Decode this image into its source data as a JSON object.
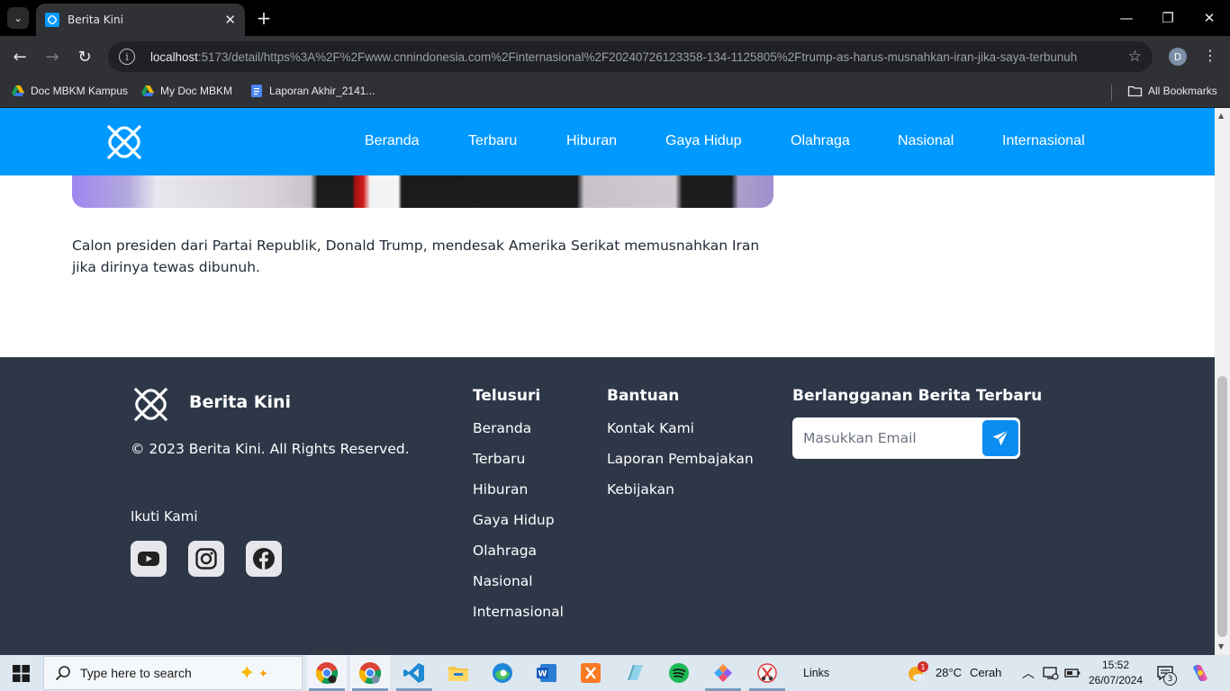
{
  "browser": {
    "tab_title": "Berita Kini",
    "url_host": "localhost",
    "url_rest": ":5173/detail/https%3A%2F%2Fwww.cnnindonesia.com%2Finternasional%2F20240726123358-134-1125805%2Ftrump-as-harus-musnahkan-iran-jika-saya-terbunuh",
    "profile_initial": "D",
    "bookmarks": [
      "Doc MBKM Kampus",
      "My Doc MBKM",
      "Laporan Akhir_2141...",
      "All Bookmarks"
    ]
  },
  "site": {
    "nav": [
      "Beranda",
      "Terbaru",
      "Hiburan",
      "Gaya Hidup",
      "Olahraga",
      "Nasional",
      "Internasional"
    ],
    "brand_color": "#0099ff"
  },
  "article": {
    "paragraph": "Calon presiden dari Partai Republik, Donald Trump, mendesak Amerika Serikat memusnahkan Iran jika dirinya tewas dibunuh."
  },
  "footer": {
    "brand": "Berita Kini",
    "copyright": "© 2023 Berita Kini. All Rights Reserved.",
    "follow_label": "Ikuti Kami",
    "explore_title": "Telusuri",
    "explore_links": [
      "Beranda",
      "Terbaru",
      "Hiburan",
      "Gaya Hidup",
      "Olahraga",
      "Nasional",
      "Internasional"
    ],
    "help_title": "Bantuan",
    "help_links": [
      "Kontak Kami",
      "Laporan Pembajakan",
      "Kebijakan"
    ],
    "subscribe_title": "Berlangganan Berita Terbaru",
    "email_placeholder": "Masukkan Email",
    "bg_color": "#2d3748"
  },
  "taskbar": {
    "search_placeholder": "Type here to search",
    "links_label": "Links",
    "weather_temp": "28°C",
    "weather_desc": "Cerah",
    "weather_badge": "1",
    "time": "15:52",
    "date": "26/07/2024",
    "notification_count": "3"
  }
}
